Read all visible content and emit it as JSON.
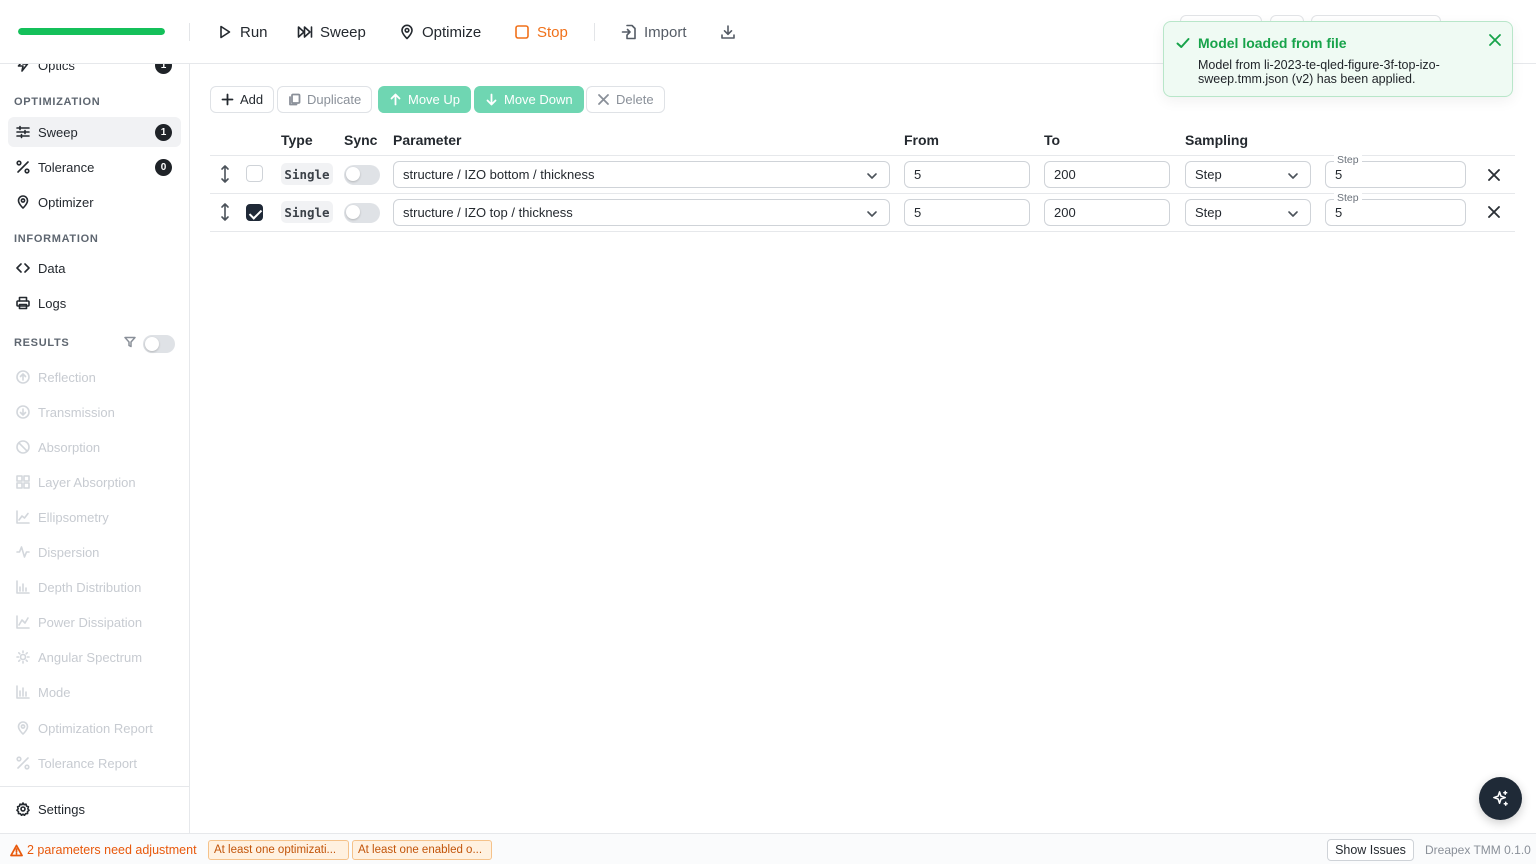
{
  "toolbar": {
    "progress_percent": 100,
    "progress_color": "#14c05a",
    "run_label": "Run",
    "sweep_label": "Sweep",
    "optimize_label": "Optimize",
    "stop_label": "Stop",
    "stop_color": "#f0711a",
    "import_label": "Import"
  },
  "toast": {
    "title": "Model loaded from file",
    "message": "Model from li-2023-te-qled-figure-3f-top-izo-sweep.tmm.json (v2) has been applied.",
    "color": "#17a34a"
  },
  "sidebar": {
    "partial_item": {
      "label": "Optics",
      "badge": "1"
    },
    "optimization": {
      "label": "OPTIMIZATION",
      "items": [
        {
          "label": "Sweep",
          "badge": "1",
          "icon": "sliders-icon",
          "active": true
        },
        {
          "label": "Tolerance",
          "badge": "0",
          "icon": "percent-icon"
        },
        {
          "label": "Optimizer",
          "icon": "map-pin-icon"
        }
      ]
    },
    "information": {
      "label": "INFORMATION",
      "items": [
        {
          "label": "Data",
          "icon": "code-icon"
        },
        {
          "label": "Logs",
          "icon": "printer-icon"
        }
      ]
    },
    "results": {
      "label": "RESULTS",
      "items": [
        {
          "label": "Reflection",
          "icon": "arrow-up-circle-icon"
        },
        {
          "label": "Transmission",
          "icon": "arrow-down-circle-icon"
        },
        {
          "label": "Absorption",
          "icon": "slash-circle-icon"
        },
        {
          "label": "Layer Absorption",
          "icon": "layout-grid-icon"
        },
        {
          "label": "Ellipsometry",
          "icon": "line-chart-icon"
        },
        {
          "label": "Dispersion",
          "icon": "activity-icon"
        },
        {
          "label": "Depth Distribution",
          "icon": "bar-chart-icon"
        },
        {
          "label": "Power Dissipation",
          "icon": "area-chart-icon"
        },
        {
          "label": "Angular Spectrum",
          "icon": "sun-icon"
        },
        {
          "label": "Mode",
          "icon": "bar-chart-icon"
        },
        {
          "label": "Optimization Report",
          "icon": "map-pin-icon"
        },
        {
          "label": "Tolerance Report",
          "icon": "percent-icon"
        }
      ]
    },
    "settings_label": "Settings"
  },
  "actions": {
    "add": "Add",
    "duplicate": "Duplicate",
    "move_up": "Move Up",
    "move_down": "Move Down",
    "delete": "Delete",
    "teal_color": "#6fd6b2"
  },
  "table": {
    "headers": {
      "type": "Type",
      "sync": "Sync",
      "parameter": "Parameter",
      "from": "From",
      "to": "To",
      "sampling": "Sampling"
    },
    "rows": [
      {
        "checked": false,
        "type": "Single",
        "sync": false,
        "parameter": "structure / IZO bottom / thickness",
        "from": "5",
        "to": "200",
        "sampling": "Step",
        "step_label": "Step",
        "step": "5"
      },
      {
        "checked": true,
        "type": "Single",
        "sync": false,
        "parameter": "structure / IZO top / thickness",
        "from": "5",
        "to": "200",
        "sampling": "Step",
        "step_label": "Step",
        "step": "5"
      }
    ]
  },
  "status": {
    "warning": "2 parameters need adjustment",
    "warning_color": "#e8590c",
    "chips": [
      "At least one optimizati...",
      "At least one enabled o..."
    ],
    "show_issues": "Show Issues",
    "version": "Dreapex TMM 0.1.0"
  }
}
